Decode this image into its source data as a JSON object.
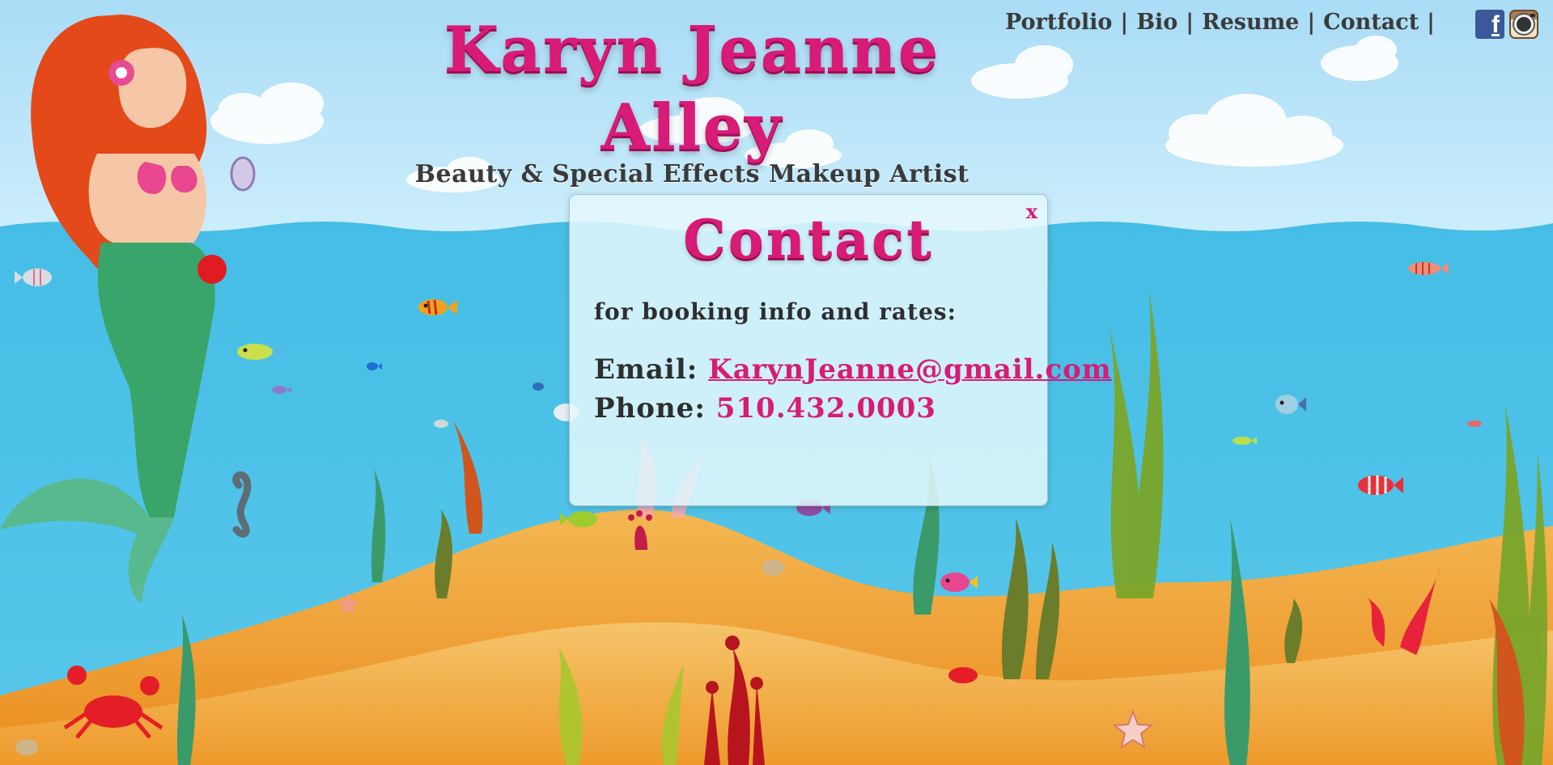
{
  "brand": {
    "name": "Karyn Jeanne Alley",
    "tagline": "Beauty & Special Effects Makeup Artist"
  },
  "nav": {
    "items": [
      {
        "label": "Portfolio"
      },
      {
        "label": "Bio"
      },
      {
        "label": "Resume"
      },
      {
        "label": "Contact"
      }
    ],
    "separator": "|"
  },
  "social": {
    "facebook_icon": "facebook-icon",
    "facebook_glyph": "f",
    "instagram_icon": "instagram-icon"
  },
  "modal": {
    "title": "Contact",
    "close_label": "x",
    "intro": "for booking info and rates:",
    "email_label": "Email:",
    "email_value": "KarynJeanne@gmail.com",
    "phone_label": "Phone:",
    "phone_value": "510.432.0003"
  },
  "colors": {
    "accent": "#d81b77",
    "sky": "#b9e4f8",
    "water": "#4ec3e7",
    "sand": "#f2b04e",
    "text": "#3b3b3b"
  }
}
